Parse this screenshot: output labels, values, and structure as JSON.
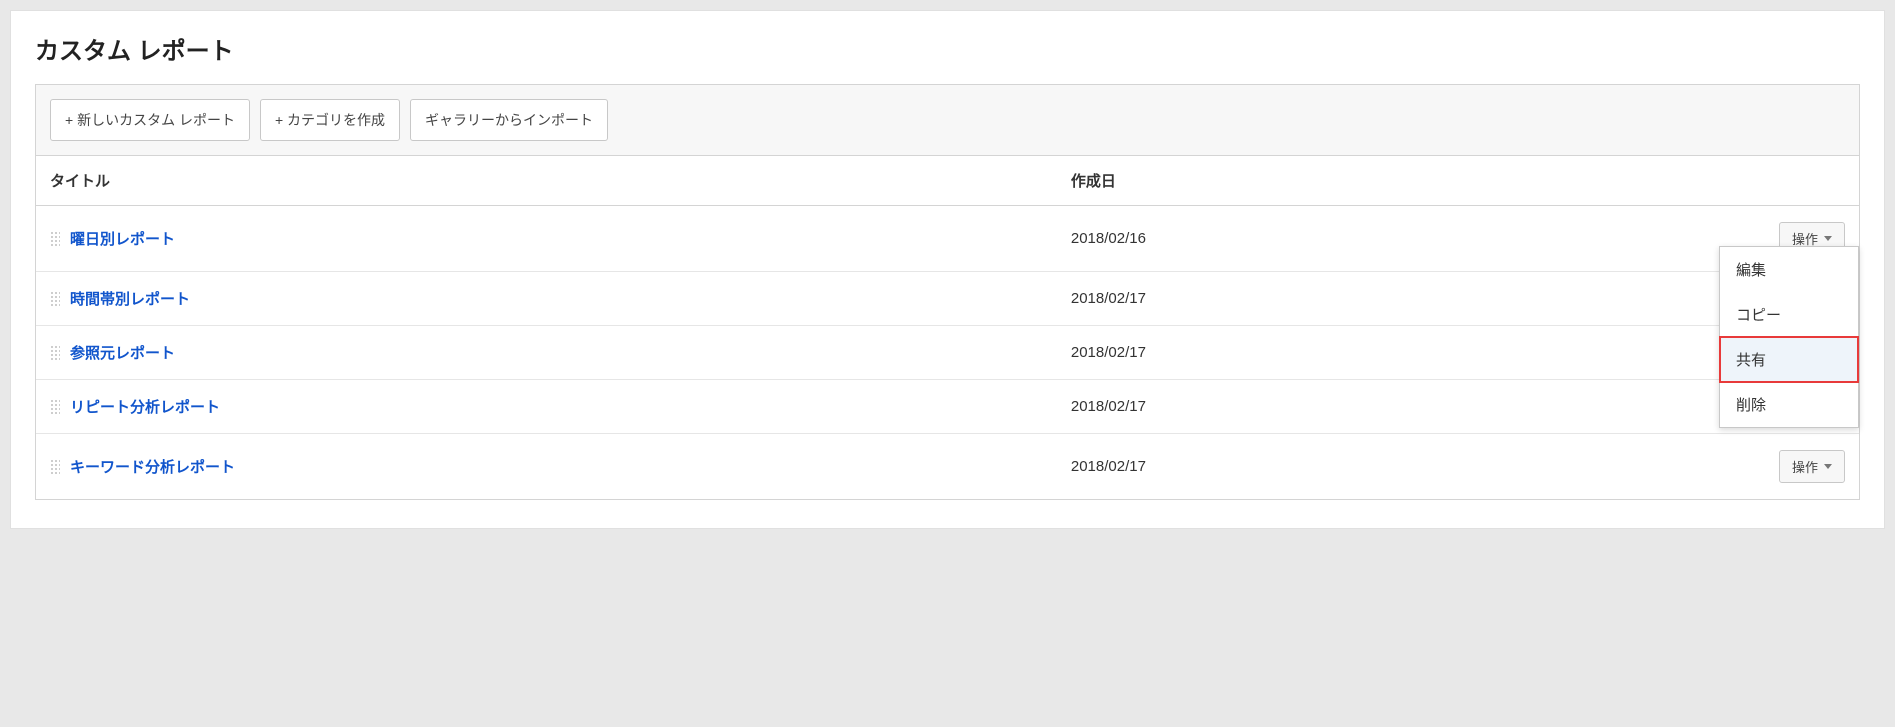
{
  "page_title": "カスタム レポート",
  "toolbar": {
    "new_report": "+ 新しいカスタム レポート",
    "new_category": "+ カテゴリを作成",
    "import_gallery": "ギャラリーからインポート"
  },
  "table": {
    "headers": {
      "title": "タイトル",
      "created": "作成日"
    },
    "action_label": "操作",
    "rows": [
      {
        "title": "曜日別レポート",
        "created": "2018/02/16",
        "show_action": true,
        "dropdown_open": true
      },
      {
        "title": "時間帯別レポート",
        "created": "2018/02/17",
        "show_action": false
      },
      {
        "title": "参照元レポート",
        "created": "2018/02/17",
        "show_action": false
      },
      {
        "title": "リピート分析レポート",
        "created": "2018/02/17",
        "show_action": false
      },
      {
        "title": "キーワード分析レポート",
        "created": "2018/02/17",
        "show_action": true
      }
    ]
  },
  "dropdown": {
    "items": [
      {
        "label": "編集",
        "highlighted": false
      },
      {
        "label": "コピー",
        "highlighted": false
      },
      {
        "label": "共有",
        "highlighted": true
      },
      {
        "label": "削除",
        "highlighted": false
      }
    ]
  }
}
